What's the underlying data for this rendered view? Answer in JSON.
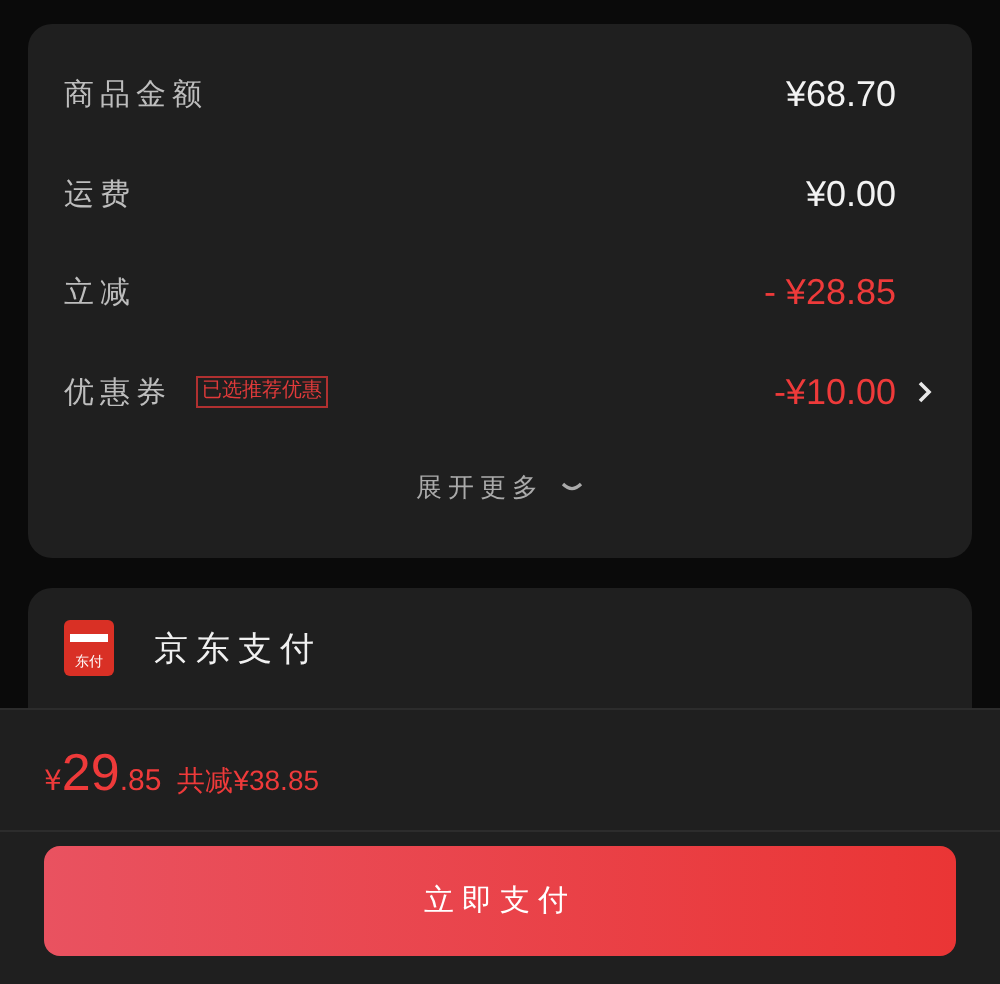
{
  "summary": {
    "rows": [
      {
        "label": "商品金额",
        "value": "¥68.70",
        "kind": "charge",
        "link": false
      },
      {
        "label": "运费",
        "value": "¥0.00",
        "kind": "charge",
        "link": false
      },
      {
        "label": "立减",
        "value": "- ¥28.85",
        "kind": "discount",
        "link": false
      },
      {
        "label": "优惠券",
        "tag": "已选推荐优惠",
        "value": "-¥10.00",
        "kind": "discount",
        "link": true
      }
    ],
    "expand": "展开更多"
  },
  "payment": {
    "icon_text": "东付",
    "name": "京东支付"
  },
  "footer": {
    "total": {
      "currency": "¥",
      "integer": "29",
      "decimal": ".85"
    },
    "saving": "共减¥38.85",
    "button": "立即支付"
  }
}
